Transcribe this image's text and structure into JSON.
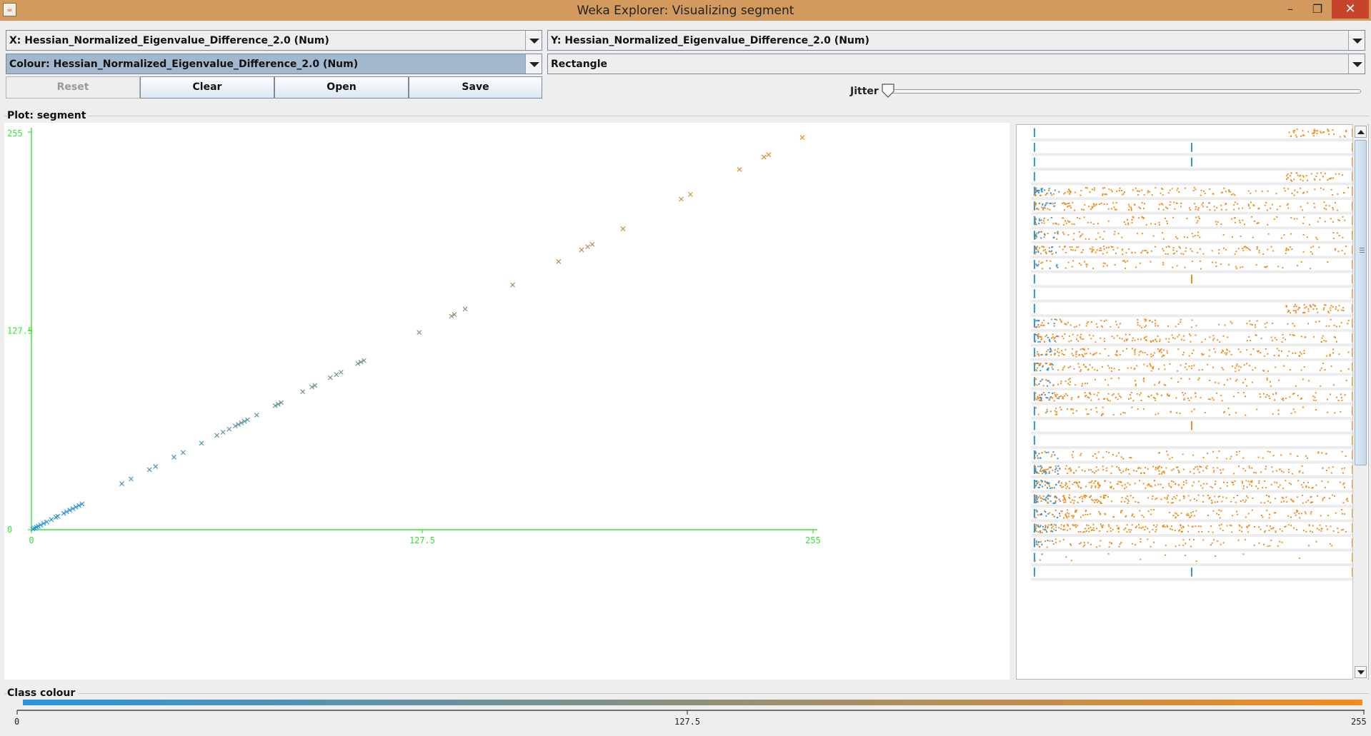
{
  "window": {
    "title": "Weka Explorer: Visualizing segment",
    "icon": "java-cup-icon",
    "minimize_glyph": "–",
    "maximize_glyph": "❐",
    "close_glyph": "✕"
  },
  "controls": {
    "x_axis": "X: Hessian_Normalized_Eigenvalue_Difference_2.0 (Num)",
    "y_axis": "Y: Hessian_Normalized_Eigenvalue_Difference_2.0 (Num)",
    "colour": "Colour: Hessian_Normalized_Eigenvalue_Difference_2.0 (Num)",
    "shape": "Rectangle",
    "reset_label": "Reset",
    "clear_label": "Clear",
    "open_label": "Open",
    "save_label": "Save",
    "jitter_label": "Jitter",
    "jitter_value": 0
  },
  "plot": {
    "label": "Plot: segment"
  },
  "class_colour": {
    "label": "Class colour",
    "min": "0",
    "mid": "127.5",
    "max": "255",
    "low_color": "#2a95db",
    "high_color": "#f28c1c"
  },
  "colors": {
    "axis": "#33e533",
    "low": "#2a95db",
    "high": "#f28c1c"
  },
  "chart_data": {
    "type": "scatter",
    "marker": "x",
    "xlim": [
      0,
      255
    ],
    "ylim": [
      0,
      255
    ],
    "x_ticks": [
      "0",
      "127.5",
      "255"
    ],
    "y_ticks": [
      "0",
      "127.5",
      "255"
    ],
    "points": [
      0.5,
      1,
      1.6,
      2.2,
      3,
      4,
      5,
      6.5,
      8,
      8.6,
      10.5,
      11.5,
      12.5,
      13.5,
      14.5,
      15.5,
      16.5,
      29.5,
      32.5,
      38.5,
      40.5,
      46.5,
      49.5,
      55.5,
      60.5,
      62.5,
      64.5,
      66.5,
      67.5,
      68.5,
      69.5,
      70.5,
      73.5,
      79.5,
      80.5,
      81.5,
      88.5,
      91.5,
      92.5,
      97.5,
      99.5,
      101,
      106.5,
      107.5,
      108.5,
      126.5,
      137,
      138,
      141.5,
      157,
      172,
      179.5,
      181.5,
      183,
      193,
      212,
      215,
      231,
      239,
      240.5,
      251.5
    ]
  }
}
